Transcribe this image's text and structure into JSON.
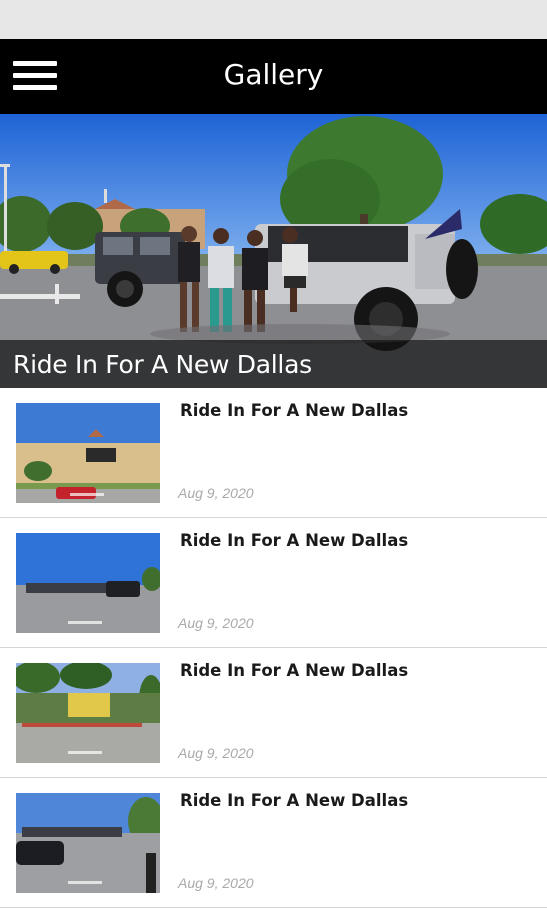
{
  "app": {
    "title": "Gallery",
    "menu_icon": "hamburger-menu-icon"
  },
  "hero": {
    "caption": "Ride In For A New Dallas"
  },
  "items": [
    {
      "title": "Ride In For A New Dallas",
      "date": "Aug 9, 2020"
    },
    {
      "title": "Ride In For A New Dallas",
      "date": "Aug 9, 2020"
    },
    {
      "title": "Ride In For A New Dallas",
      "date": "Aug 9, 2020"
    },
    {
      "title": "Ride In For A New Dallas",
      "date": "Aug 9, 2020"
    }
  ],
  "colors": {
    "appbar": "#000000",
    "statusbar": "#e7e7e7",
    "date": "#a9a9a9"
  }
}
